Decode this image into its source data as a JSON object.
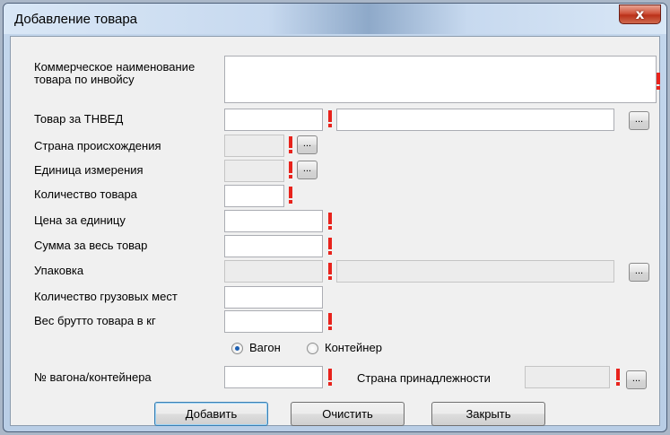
{
  "window": {
    "title": "Добавление товара",
    "close_glyph": "x"
  },
  "form": {
    "commercial_name_label": "Коммерческое наименование товара по инвойсу",
    "commercial_name_value": "",
    "tnved_label": "Товар за ТНВЕД",
    "tnved_code_value": "",
    "tnved_desc_value": "",
    "origin_label": "Страна происхождения",
    "origin_value": "",
    "unit_label": "Единица измерения",
    "unit_value": "",
    "quantity_label": "Количество товара",
    "quantity_value": "",
    "unit_price_label": "Цена за единицу",
    "unit_price_value": "",
    "total_label": "Сумма за весь товар",
    "total_value": "",
    "packaging_label": "Упаковка",
    "packaging_code_value": "",
    "packaging_desc_value": "",
    "cargo_places_label": "Количество грузовых мест",
    "cargo_places_value": "",
    "gross_weight_label": "Вес брутто товара в кг",
    "gross_weight_value": "",
    "ellipsis": "...",
    "transport": {
      "wagon_label": "Вагон",
      "container_label": "Контейнер",
      "selected": "Вагон"
    },
    "wagon_number_label": "№ вагона/контейнера",
    "wagon_number_value": "",
    "ownership_label": "Страна принадлежности",
    "ownership_value": ""
  },
  "buttons": {
    "add": "Добавить",
    "clear": "Очистить",
    "close": "Закрыть"
  },
  "colors": {
    "required_marker": "#e8231c",
    "disabled_field": "#ececec"
  }
}
